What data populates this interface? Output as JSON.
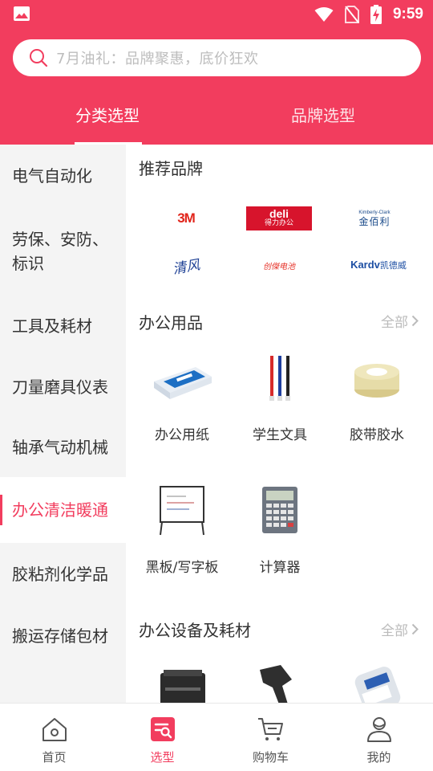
{
  "status_bar": {
    "time": "9:59"
  },
  "search": {
    "placeholder": "7月油礼：品牌聚惠，底价狂欢"
  },
  "top_tabs": [
    {
      "label": "分类选型",
      "active": true
    },
    {
      "label": "品牌选型",
      "active": false
    }
  ],
  "sidebar": {
    "items": [
      {
        "label": "电气自动化",
        "active": false
      },
      {
        "label": "劳保、安防、标识",
        "active": false
      },
      {
        "label": "工具及耗材",
        "active": false
      },
      {
        "label": "刀量磨具仪表",
        "active": false
      },
      {
        "label": "轴承气动机械",
        "active": false
      },
      {
        "label": "办公清洁暖通",
        "active": true
      },
      {
        "label": "胶粘剂化学品",
        "active": false
      },
      {
        "label": "搬运存储包材",
        "active": false
      }
    ]
  },
  "recommended_brands": {
    "title": "推荐品牌",
    "brands": [
      {
        "name": "3M",
        "text": "3M"
      },
      {
        "name": "deli",
        "text": "deli",
        "sub": "得力办公"
      },
      {
        "name": "kimberly-clark",
        "text": "Kimberly-Clark",
        "sub": "金佰利"
      },
      {
        "name": "qingfeng",
        "text": "清风"
      },
      {
        "name": "chuangji",
        "text": "创傑电池"
      },
      {
        "name": "kardv",
        "text": "Kardv",
        "sub": "凯德威"
      }
    ]
  },
  "office_supplies": {
    "title": "办公用品",
    "all_label": "全部",
    "items": [
      {
        "label": "办公用纸",
        "icon": "paper-pack"
      },
      {
        "label": "学生文具",
        "icon": "pens"
      },
      {
        "label": "胶带胶水",
        "icon": "tape-roll"
      },
      {
        "label": "黑板/写字板",
        "icon": "whiteboard"
      },
      {
        "label": "计算器",
        "icon": "calculator"
      }
    ]
  },
  "office_equipment": {
    "title": "办公设备及耗材",
    "all_label": "全部",
    "items": [
      {
        "icon": "printer"
      },
      {
        "icon": "barcode-scanner"
      },
      {
        "icon": "label-maker"
      }
    ]
  },
  "bottom_nav": [
    {
      "label": "首页",
      "icon": "home-icon",
      "active": false
    },
    {
      "label": "选型",
      "icon": "select-icon",
      "active": true
    },
    {
      "label": "购物车",
      "icon": "cart-icon",
      "active": false
    },
    {
      "label": "我的",
      "icon": "profile-icon",
      "active": false
    }
  ],
  "colors": {
    "accent": "#f23d5e",
    "sidebar_bg": "#f4f4f4"
  }
}
